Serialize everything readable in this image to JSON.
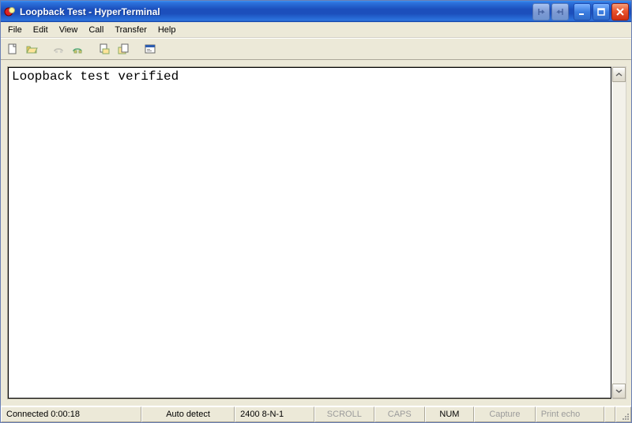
{
  "window": {
    "title": "Loopback Test - HyperTerminal"
  },
  "title_buttons": {
    "dock_left": "dock-left",
    "dock_right": "dock-right",
    "minimize": "minimize",
    "maximize": "maximize",
    "close": "close"
  },
  "menubar": {
    "items": [
      "File",
      "Edit",
      "View",
      "Call",
      "Transfer",
      "Help"
    ]
  },
  "toolbar": {
    "buttons": [
      {
        "name": "new-icon",
        "interactable": true,
        "disabled": false
      },
      {
        "name": "open-icon",
        "interactable": true,
        "disabled": false
      },
      {
        "gap": true
      },
      {
        "name": "connect-icon",
        "interactable": true,
        "disabled": true
      },
      {
        "name": "disconnect-icon",
        "interactable": true,
        "disabled": false
      },
      {
        "gap": true
      },
      {
        "name": "send-icon",
        "interactable": true,
        "disabled": false
      },
      {
        "name": "receive-icon",
        "interactable": true,
        "disabled": false
      },
      {
        "gap": true
      },
      {
        "name": "properties-icon",
        "interactable": true,
        "disabled": false
      }
    ]
  },
  "terminal": {
    "content": "Loopback test verified"
  },
  "statusbar": {
    "conn": "Connected 0:00:18",
    "detect": "Auto detect",
    "port": "2400 8-N-1",
    "scroll": "SCROLL",
    "caps": "CAPS",
    "num": "NUM",
    "capture": "Capture",
    "echo": "Print echo"
  }
}
